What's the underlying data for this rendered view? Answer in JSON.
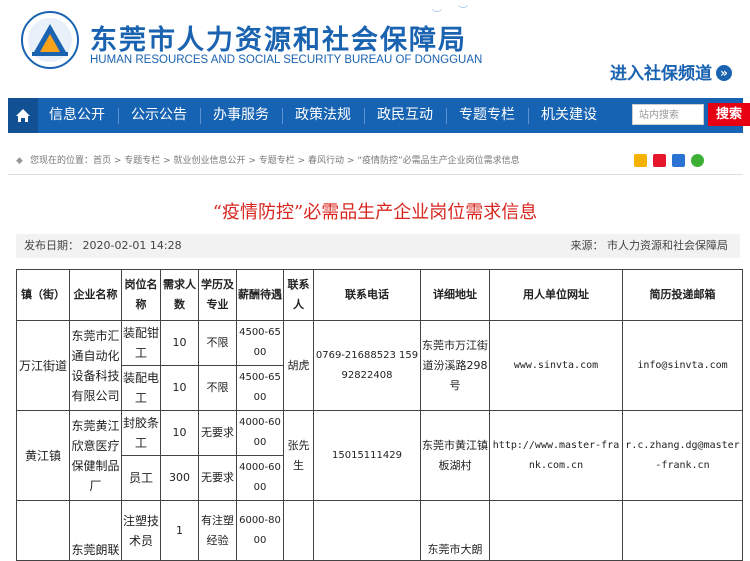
{
  "header": {
    "site_title_cn": "东莞市人力资源和社会保障局",
    "site_title_en": "HUMAN RESOURCES AND SOCIAL SECURITY BUREAU OF DONGGUAN",
    "social_link": "进入社保频道",
    "social_arrow": "»"
  },
  "nav": {
    "items": [
      "信息公开",
      "公示公告",
      "办事服务",
      "政策法规",
      "政民互动",
      "专题专栏",
      "机关建设"
    ],
    "search_placeholder": "站内搜索",
    "search_button": "搜索"
  },
  "breadcrumb": {
    "text": "您现在的位置：首页 > 专题专栏 > 就业创业信息公开 > 专题专栏 > 春风行动 > “疫情防控”必需品生产企业岗位需求信息"
  },
  "article": {
    "title": "“疫情防控”必需品生产企业岗位需求信息",
    "publish_date": "发布日期：  2020-02-01 14:28",
    "source": "来源：  市人力资源和社会保障局"
  },
  "table": {
    "headers": [
      "镇（街）",
      "企业名称",
      "岗位名称",
      "需求人数",
      "学历及专业",
      "薪酬待遇",
      "联系人",
      "联系电话",
      "详细地址",
      "用人单位网址",
      "简历投递邮箱"
    ],
    "rows": {
      "r1": {
        "town": "万江街道",
        "company": "东莞市汇通自动化设备科技有限公司",
        "job1": "装配钳工",
        "count1": "10",
        "edu1": "不限",
        "pay1": "4500-6500",
        "job2": "装配电工",
        "count2": "10",
        "edu2": "不限",
        "pay2": "4500-6500",
        "contact": "胡虎",
        "phone": "0769-21688523 15992822408",
        "address": "东莞市万江街道汾溪路298号",
        "website": "www.sinvta.com",
        "email": "info@sinvta.com"
      },
      "r2": {
        "town": "黄江镇",
        "company": "东莞黄江欣意医疗保健制品厂",
        "job1": "封胶条工",
        "count1": "10",
        "edu1": "无要求",
        "pay1": "4000-6000",
        "job2": "员工",
        "count2": "300",
        "edu2": "无要求",
        "pay2": "4000-6000",
        "contact": "张先生",
        "phone": "15015111429",
        "address": "东莞市黄江镇板湖村",
        "website": "http://www.master-frank.com.cn",
        "email": "r.c.zhang.dg@master-frank.cn"
      },
      "r3": {
        "town": "",
        "company": "东莞朗联",
        "job1": "注塑技术员",
        "count1": "1",
        "edu1": "有注塑经验",
        "pay1": "6000-8000",
        "contact": "",
        "address": "东莞市大朗"
      }
    }
  },
  "colors": {
    "brand_blue": "#1763b3",
    "title_red": "#d8261f",
    "search_red": "#e60012"
  }
}
